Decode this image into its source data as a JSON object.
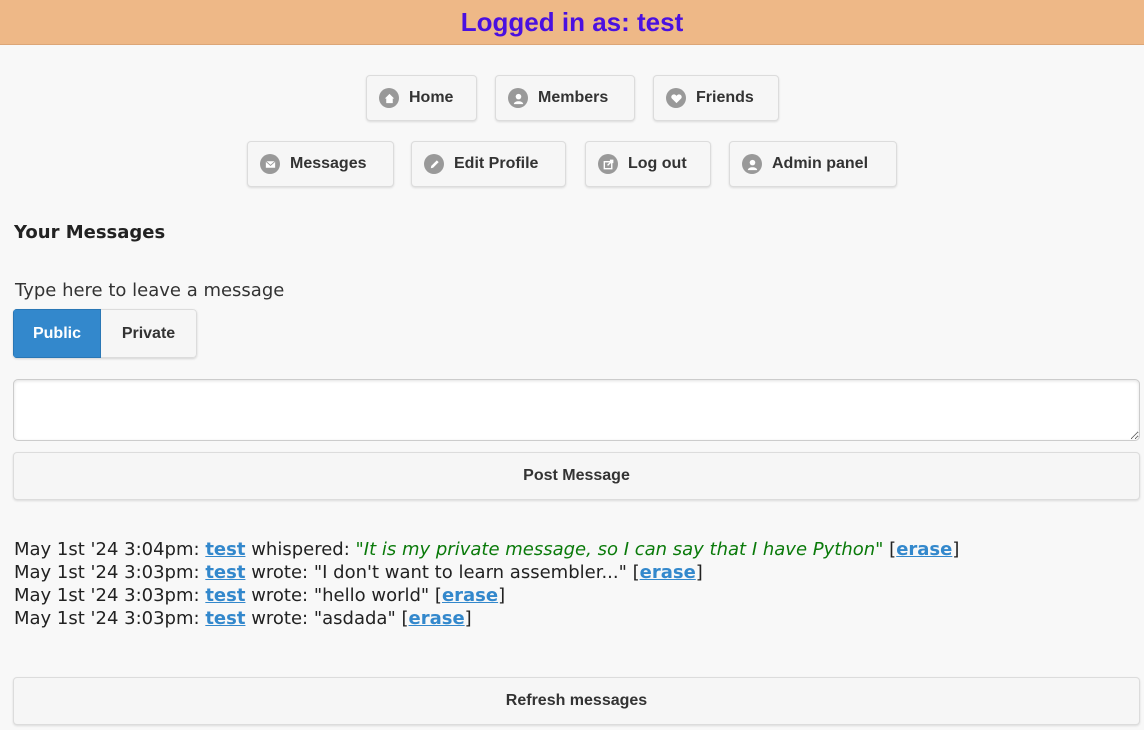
{
  "header": {
    "title": "Logged in as: test"
  },
  "nav": {
    "row1": [
      {
        "label": "Home",
        "icon": "home-icon"
      },
      {
        "label": "Members",
        "icon": "user-icon"
      },
      {
        "label": "Friends",
        "icon": "heart-icon"
      }
    ],
    "row2": [
      {
        "label": "Messages",
        "icon": "mail-icon"
      },
      {
        "label": "Edit Profile",
        "icon": "pencil-icon"
      },
      {
        "label": "Log out",
        "icon": "logout-icon"
      },
      {
        "label": "Admin panel",
        "icon": "user-icon"
      }
    ]
  },
  "messages_section": {
    "title": "Your Messages",
    "hint": "Type here to leave a message",
    "visibility": {
      "public_label": "Public",
      "private_label": "Private",
      "selected": "Public"
    },
    "textarea_value": "",
    "post_label": "Post Message",
    "refresh_label": "Refresh messages"
  },
  "messages": [
    {
      "time": "May 1st '24 3:04pm:",
      "user": "test",
      "verb": "whispered:",
      "text": "\"It is my private message, so I can say that I have Python\"",
      "private": true,
      "erase": "erase"
    },
    {
      "time": "May 1st '24 3:03pm:",
      "user": "test",
      "verb": "wrote:",
      "text": "\"I don't want to learn assembler...\"",
      "private": false,
      "erase": "erase"
    },
    {
      "time": "May 1st '24 3:03pm:",
      "user": "test",
      "verb": "wrote:",
      "text": "\"hello world\"",
      "private": false,
      "erase": "erase"
    },
    {
      "time": "May 1st '24 3:03pm:",
      "user": "test",
      "verb": "wrote:",
      "text": "\"asdada\"",
      "private": false,
      "erase": "erase"
    }
  ],
  "colors": {
    "header_bg": "#eeb887",
    "header_text": "#4a10e0",
    "accent": "#3388cc",
    "whisper": "#0a7a0a"
  }
}
